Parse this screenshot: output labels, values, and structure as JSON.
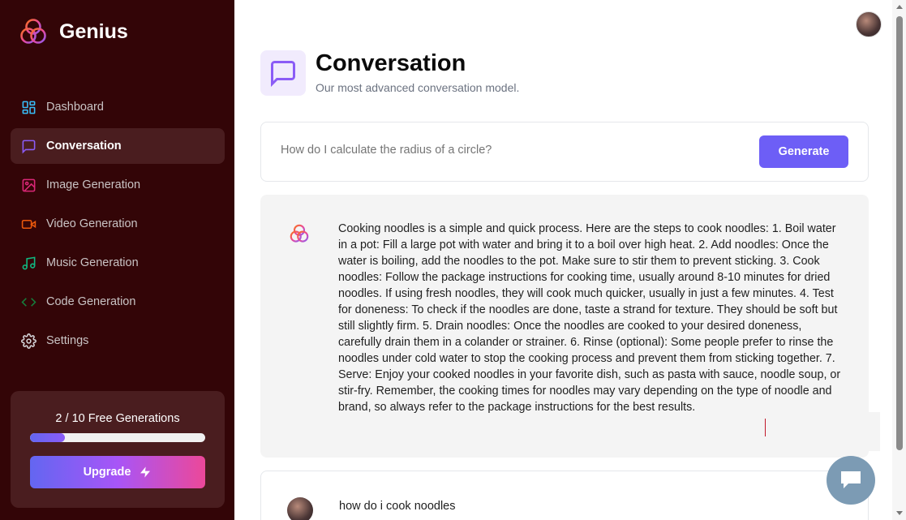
{
  "brand": {
    "name": "Genius",
    "icon": "genius-logo-icon"
  },
  "sidebar": {
    "items": [
      {
        "label": "Dashboard",
        "icon": "layout-dashboard-icon",
        "color": "#38bdf8",
        "active": false
      },
      {
        "label": "Conversation",
        "icon": "message-square-icon",
        "color": "#8b5cf6",
        "active": true
      },
      {
        "label": "Image Generation",
        "icon": "image-icon",
        "color": "#db2777",
        "active": false
      },
      {
        "label": "Video Generation",
        "icon": "video-icon",
        "color": "#ea580c",
        "active": false
      },
      {
        "label": "Music Generation",
        "icon": "music-icon",
        "color": "#10b981",
        "active": false
      },
      {
        "label": "Code Generation",
        "icon": "code-icon",
        "color": "#15803d",
        "active": false
      },
      {
        "label": "Settings",
        "icon": "settings-icon",
        "color": "#d4d4d8",
        "active": false
      }
    ],
    "free": {
      "text": "2 / 10 Free Generations",
      "used": 2,
      "limit": 10
    },
    "upgrade_label": "Upgrade",
    "upgrade_icon": "zap-icon"
  },
  "header": {
    "title": "Conversation",
    "subtitle": "Our most advanced conversation model.",
    "icon": "message-square-icon",
    "icon_color": "#8b5cf6"
  },
  "prompt": {
    "placeholder": "How do I calculate the radius of a circle?",
    "value": "",
    "generate_label": "Generate"
  },
  "messages": [
    {
      "role": "bot",
      "text": "Cooking noodles is a simple and quick process. Here are the steps to cook noodles: 1. Boil water in a pot: Fill a large pot with water and bring it to a boil over high heat. 2. Add noodles: Once the water is boiling, add the noodles to the pot. Make sure to stir them to prevent sticking. 3. Cook noodles: Follow the package instructions for cooking time, usually around 8-10 minutes for dried noodles. If using fresh noodles, they will cook much quicker, usually in just a few minutes. 4. Test for doneness: To check if the noodles are done, taste a strand for texture. They should be soft but still slightly firm. 5. Drain noodles: Once the noodles are cooked to your desired doneness, carefully drain them in a colander or strainer. 6. Rinse (optional): Some people prefer to rinse the noodles under cold water to stop the cooking process and prevent them from sticking together. 7. Serve: Enjoy your cooked noodles in your favorite dish, such as pasta with sauce, noodle soup, or stir-fry. Remember, the cooking times for noodles may vary depending on the type of noodle and brand, so always refer to the package instructions for the best results."
    },
    {
      "role": "user",
      "text": "how do i cook noodles"
    }
  ],
  "colors": {
    "sidebar_bg": "#330507",
    "accent": "#6d5ef6"
  }
}
